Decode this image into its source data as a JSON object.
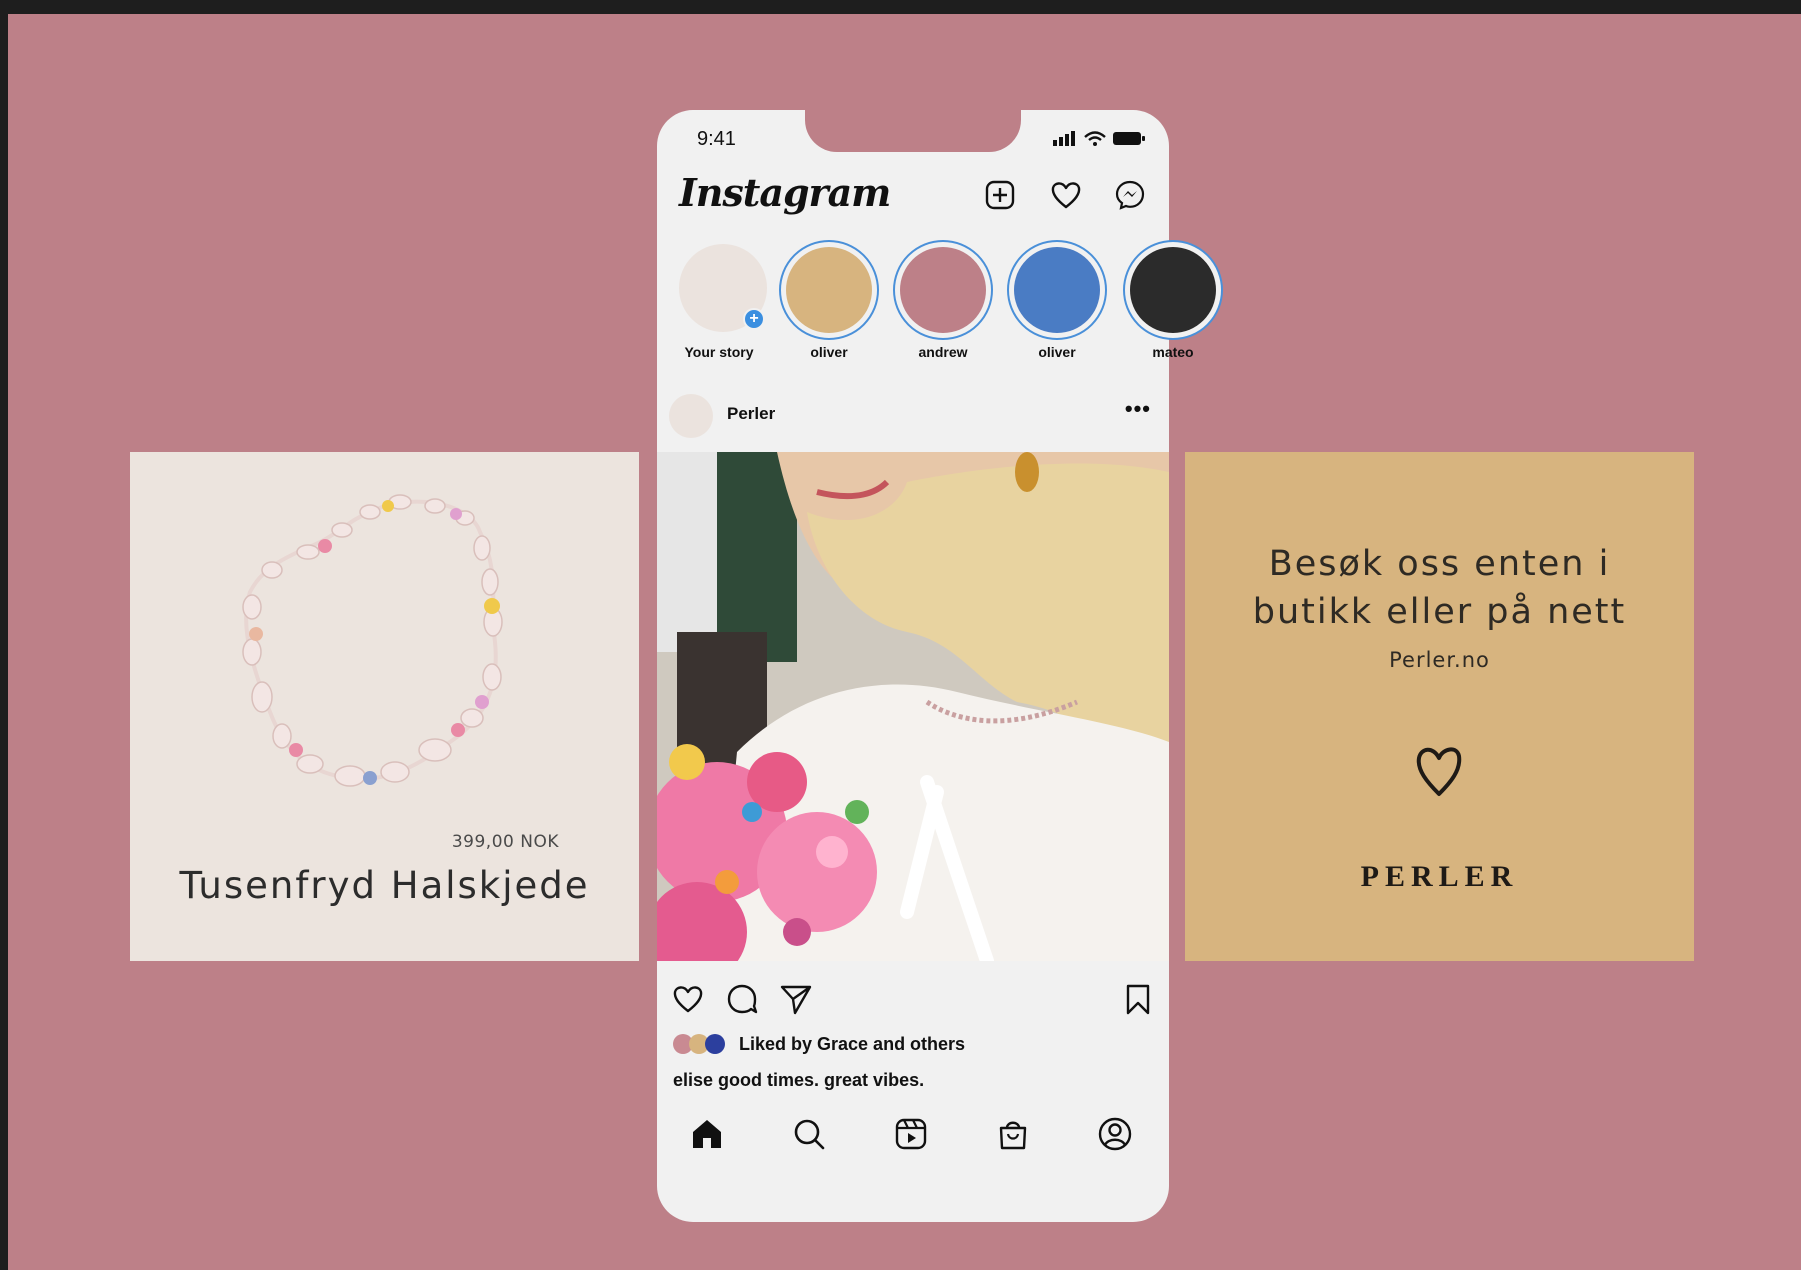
{
  "phone": {
    "status_time": "9:41",
    "app_logo": "Instagram",
    "top_icons": [
      "new-post-icon",
      "heart-icon",
      "messenger-icon"
    ],
    "stories": [
      {
        "label": "Your story",
        "color": "#ebe3de",
        "own": true
      },
      {
        "label": "oliver",
        "color": "#d7b47f"
      },
      {
        "label": "andrew",
        "color": "#bd8088"
      },
      {
        "label": "oliver",
        "color": "#4a7cc4"
      },
      {
        "label": "mateo",
        "color": "#2b2b2b"
      }
    ],
    "post": {
      "username": "Perler",
      "more": "•••",
      "liked_by": "Liked by Grace and others",
      "like_dot_colors": [
        "#c98a92",
        "#d7b47f",
        "#2c3f9e"
      ],
      "caption": "elise good times. great vibes."
    },
    "bottom_nav": [
      "home-icon",
      "search-icon",
      "reels-icon",
      "shop-icon",
      "profile-icon"
    ]
  },
  "left_panel": {
    "price": "399,00 NOK",
    "product_name": "Tusenfryd Halskjede"
  },
  "right_panel": {
    "line1": "Besøk oss enten i",
    "line2": "butikk eller på nett",
    "site": "Perler.no",
    "brand": "PERLER"
  },
  "colors": {
    "background": "#bd8088",
    "story_ring": "#4a90d9",
    "left_panel": "#ece4de",
    "right_panel": "#d7b47f"
  }
}
